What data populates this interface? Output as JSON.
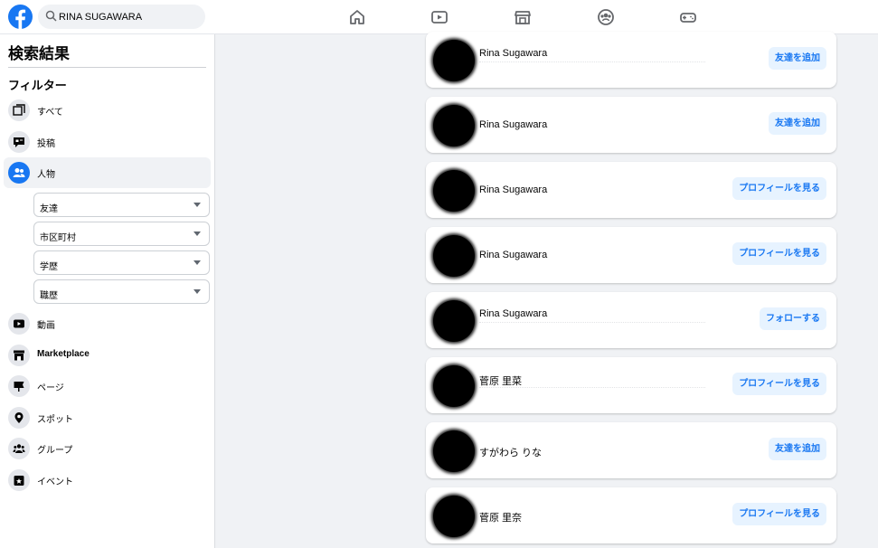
{
  "header": {
    "search_value": "RINA SUGAWARA",
    "nav": [
      "home-icon",
      "video-icon",
      "marketplace-icon",
      "groups-icon",
      "gaming-icon"
    ]
  },
  "sidebar": {
    "title": "検索結果",
    "filter_heading": "フィルター",
    "items": [
      {
        "label": "すべて",
        "icon": "all-results-icon"
      },
      {
        "label": "投稿",
        "icon": "posts-icon"
      },
      {
        "label": "人物",
        "icon": "people-icon",
        "active": true
      },
      {
        "label": "動画",
        "icon": "video-icon"
      },
      {
        "label": "Marketplace",
        "icon": "marketplace-icon"
      },
      {
        "label": "ページ",
        "icon": "flag-icon"
      },
      {
        "label": "スポット",
        "icon": "location-pin-icon"
      },
      {
        "label": "グループ",
        "icon": "groups-icon"
      },
      {
        "label": "イベント",
        "icon": "calendar-star-icon"
      }
    ],
    "people_filters": [
      {
        "label": "友達"
      },
      {
        "label": "市区町村"
      },
      {
        "label": "学歴"
      },
      {
        "label": "職歴"
      }
    ]
  },
  "results": [
    {
      "name": "Rina Sugawara",
      "action": "友達を追加"
    },
    {
      "name": "Rina Sugawara",
      "action": "友達を追加"
    },
    {
      "name": "Rina Sugawara",
      "action": "プロフィールを見る"
    },
    {
      "name": "Rina Sugawara",
      "action": "プロフィールを見る"
    },
    {
      "name": "Rina Sugawara",
      "action": "フォローする"
    },
    {
      "name": "菅原 里菜",
      "action": "プロフィールを見る"
    },
    {
      "name": "すがわら りな",
      "action": "友達を追加"
    },
    {
      "name": "菅原 里奈",
      "action": "プロフィールを見る"
    }
  ],
  "colors": {
    "brand": "#1877f2",
    "button_bg": "#e7f3ff",
    "page_bg": "#f0f2f5"
  }
}
